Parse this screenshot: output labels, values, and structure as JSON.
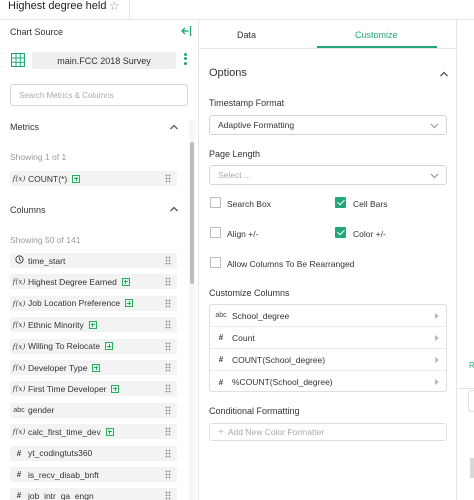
{
  "header": {
    "title": "Highest degree held"
  },
  "left_panel": {
    "chart_source_label": "Chart Source",
    "dataset": "main.FCC 2018 Survey",
    "search_placeholder": "Search Metrics & Columns",
    "metrics": {
      "title": "Metrics",
      "showing": "Showing 1 of 1",
      "items": [
        {
          "type": "f(x)",
          "label": "COUNT(*)",
          "calc": true
        }
      ]
    },
    "columns": {
      "title": "Columns",
      "showing": "Showing 50 of 141",
      "items": [
        {
          "type": "clock",
          "label": "time_start",
          "calc": false
        },
        {
          "type": "f(x)",
          "label": "Highest Degree Earned",
          "calc": true
        },
        {
          "type": "f(x)",
          "label": "Job Location Preference",
          "calc": true
        },
        {
          "type": "f(x)",
          "label": "Ethnic Minority",
          "calc": true
        },
        {
          "type": "f(x)",
          "label": "Willing To Relocate",
          "calc": true
        },
        {
          "type": "f(x)",
          "label": "Developer Type",
          "calc": true
        },
        {
          "type": "f(x)",
          "label": "First Time Developer",
          "calc": true
        },
        {
          "type": "abc",
          "label": "gender",
          "calc": false
        },
        {
          "type": "f(x)",
          "label": "calc_first_time_dev",
          "calc": true
        },
        {
          "type": "#",
          "label": "yt_codingtuts360",
          "calc": false
        },
        {
          "type": "#",
          "label": "is_recv_disab_bnft",
          "calc": false
        },
        {
          "type": "#",
          "label": "job_intr_qa_engn",
          "calc": false
        }
      ]
    }
  },
  "middle_panel": {
    "tabs": [
      {
        "label": "Data",
        "active": false
      },
      {
        "label": "Customize",
        "active": true
      }
    ],
    "options_title": "Options",
    "timestamp_format": {
      "label": "Timestamp Format",
      "value": "Adaptive Formatting"
    },
    "page_length": {
      "label": "Page Length",
      "placeholder": "Select ..."
    },
    "checkboxes": {
      "search_box": {
        "label": "Search Box",
        "checked": false
      },
      "cell_bars": {
        "label": "Cell Bars",
        "checked": true
      },
      "align": {
        "label": "Align +/-",
        "checked": false
      },
      "color": {
        "label": "Color +/-",
        "checked": true
      },
      "rearrange": {
        "label": "Allow Columns To Be Rearranged",
        "checked": false
      }
    },
    "customize_columns": {
      "label": "Customize Columns",
      "items": [
        {
          "type": "abc",
          "label": "School_degree"
        },
        {
          "type": "#",
          "label": "Count"
        },
        {
          "type": "#",
          "label": "COUNT(School_degree)"
        },
        {
          "type": "#",
          "label": "%COUNT(School_degree)"
        }
      ]
    },
    "conditional_formatting": {
      "label": "Conditional Formatting",
      "button": "Add New Color Formatter"
    }
  },
  "colors": {
    "accent": "#20a77a",
    "border": "#e5e5e5"
  }
}
